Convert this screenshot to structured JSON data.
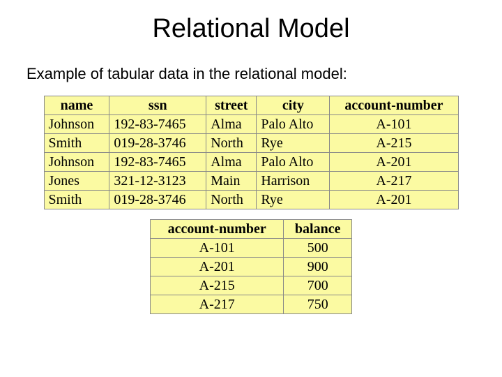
{
  "title": "Relational Model",
  "subtitle": "Example of tabular data in the relational model:",
  "table1": {
    "headers": [
      "name",
      "ssn",
      "street",
      "city",
      "account-number"
    ],
    "rows": [
      [
        "Johnson",
        "192-83-7465",
        "Alma",
        "Palo Alto",
        "A-101"
      ],
      [
        "Smith",
        "019-28-3746",
        "North",
        "Rye",
        "A-215"
      ],
      [
        "Johnson",
        "192-83-7465",
        "Alma",
        "Palo Alto",
        "A-201"
      ],
      [
        "Jones",
        "321-12-3123",
        "Main",
        "Harrison",
        "A-217"
      ],
      [
        "Smith",
        "019-28-3746",
        "North",
        "Rye",
        "A-201"
      ]
    ]
  },
  "table2": {
    "headers": [
      "account-number",
      "balance"
    ],
    "rows": [
      [
        "A-101",
        "500"
      ],
      [
        "A-201",
        "900"
      ],
      [
        "A-215",
        "700"
      ],
      [
        "A-217",
        "750"
      ]
    ]
  }
}
